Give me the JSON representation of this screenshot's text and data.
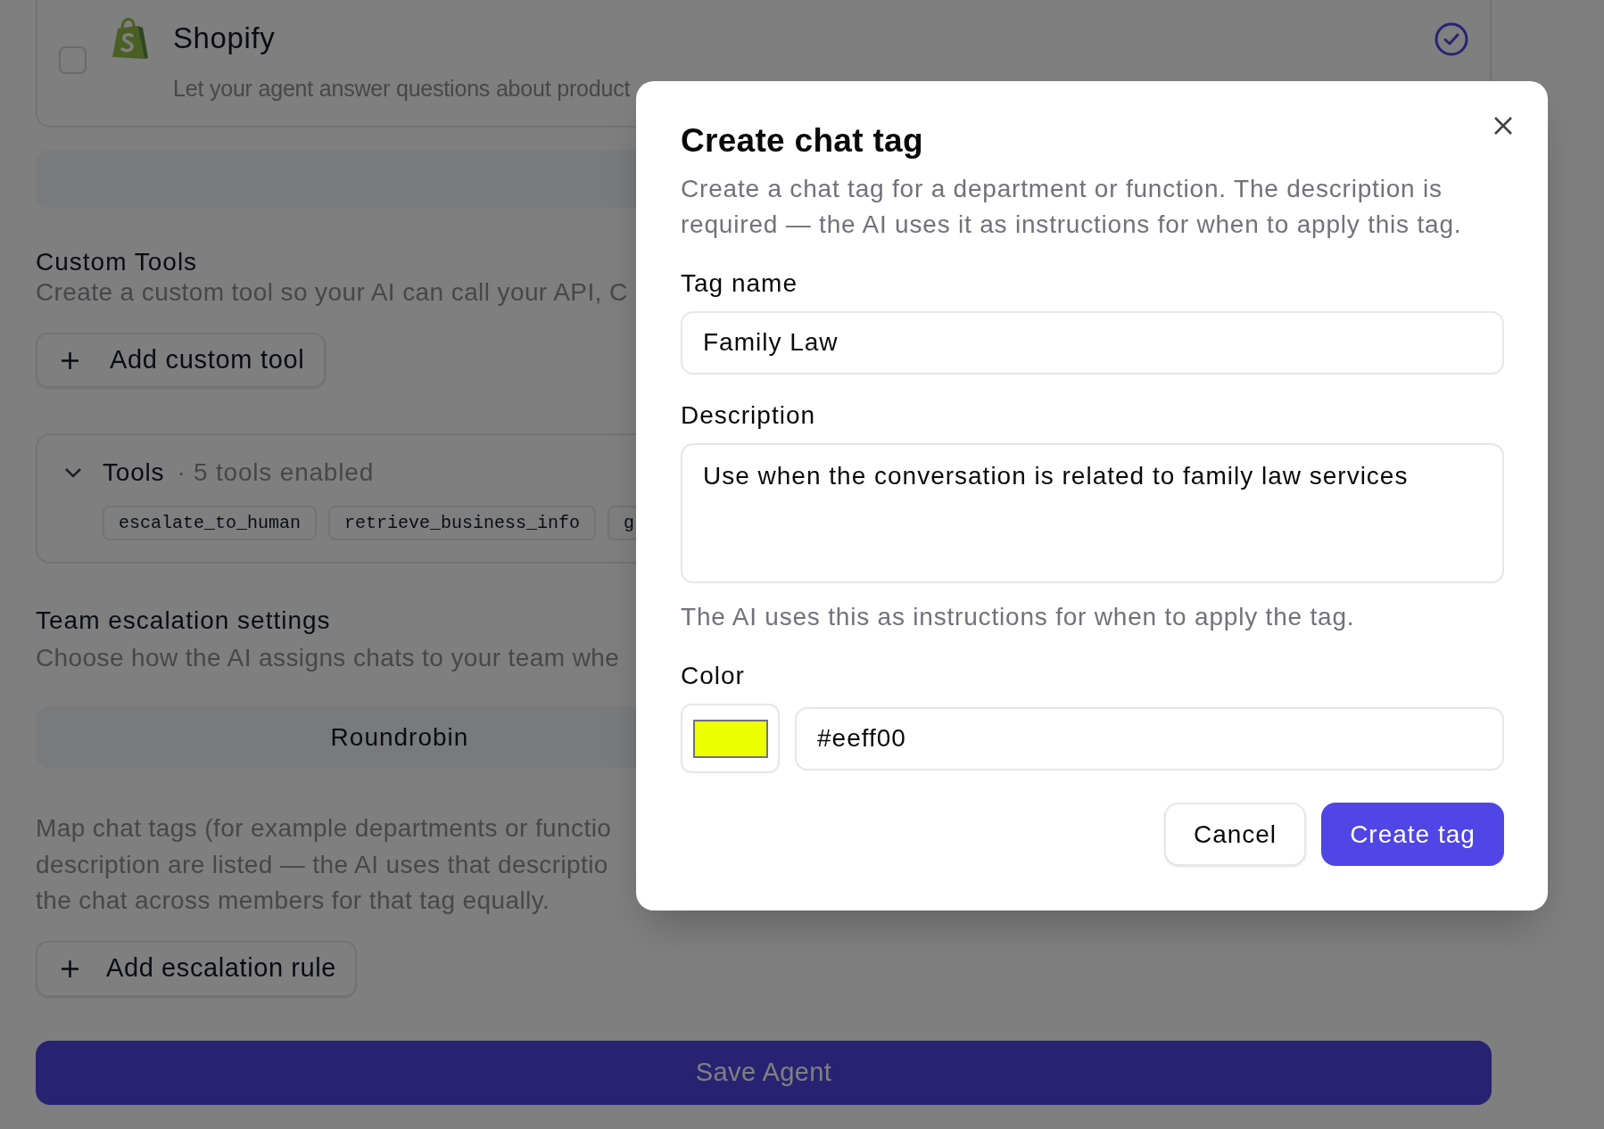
{
  "background": {
    "integration": {
      "name": "Shopify",
      "description": "Let your agent answer questions about product",
      "checked": false,
      "verified": true
    },
    "custom_tools": {
      "title": "Custom Tools",
      "description": "Create a custom tool so your AI can call your API, C",
      "add_button": "Add custom tool"
    },
    "tools_panel": {
      "title": "Tools",
      "summary": "· 5 tools enabled",
      "expanded": true,
      "chips": [
        "escalate_to_human",
        "retrieve_business_info",
        "g"
      ]
    },
    "team_escalation": {
      "title": "Team escalation settings",
      "description": "Choose how the AI assigns chats to your team whe",
      "modes": [
        {
          "label": "Roundrobin"
        }
      ],
      "note_lines": [
        "Map chat tags (for example departments or functio",
        "description are listed — the AI uses that descriptio",
        "the chat across members for that tag equally."
      ],
      "add_button": "Add escalation rule"
    },
    "save_button": "Save Agent"
  },
  "dialog": {
    "title": "Create chat tag",
    "description": "Create a chat tag for a department or function. The description is required — the AI uses it as instructions for when to apply this tag.",
    "fields": [
      {
        "kind": "text",
        "label": "Tag name",
        "value": "Family Law"
      },
      {
        "kind": "textarea",
        "label": "Description",
        "value": "Use when the conversation is related to family law services",
        "help": "The AI uses this as instructions for when to apply the tag."
      },
      {
        "kind": "color",
        "label": "Color",
        "value": "#eeff00",
        "color": "#eeff00"
      }
    ],
    "buttons": [
      {
        "kind": "secondary",
        "label": "Cancel"
      },
      {
        "kind": "primary",
        "label": "Create tag"
      }
    ]
  }
}
